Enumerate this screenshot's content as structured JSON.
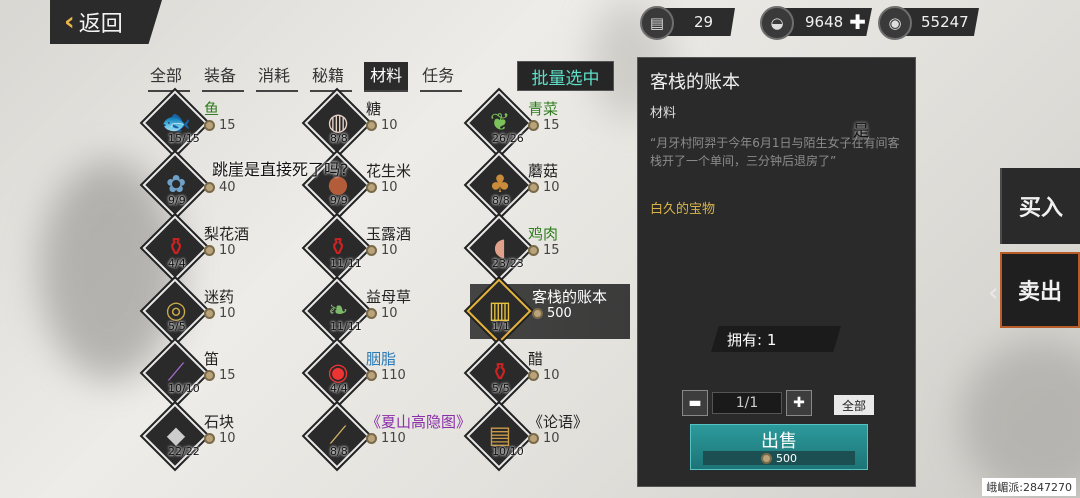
{
  "header": {
    "back_label": "返回",
    "currencies": [
      {
        "icon": "bag-icon",
        "value": "29"
      },
      {
        "icon": "silver-ingot-icon",
        "value": "9648"
      },
      {
        "icon": "copper-coin-icon",
        "value": "55247"
      }
    ]
  },
  "tabs": [
    {
      "label": "全部",
      "active": false
    },
    {
      "label": "装备",
      "active": false
    },
    {
      "label": "消耗",
      "active": false
    },
    {
      "label": "秘籍",
      "active": false
    },
    {
      "label": "材料",
      "active": true
    },
    {
      "label": "任务",
      "active": false
    }
  ],
  "batch_select_label": "批量选中",
  "items": [
    {
      "name": "鱼",
      "price": "15",
      "qty": "15/15",
      "color": "green",
      "icon": "fish-icon"
    },
    {
      "name": "糖",
      "price": "10",
      "qty": "8/8",
      "color": "",
      "icon": "sugar-icon"
    },
    {
      "name": "青菜",
      "price": "15",
      "qty": "26/26",
      "color": "green",
      "icon": "greens-icon"
    },
    {
      "name": "",
      "price": "40",
      "qty": "9/9",
      "color": "blue",
      "icon": "herb-icon"
    },
    {
      "name": "花生米",
      "price": "10",
      "qty": "9/9",
      "color": "",
      "icon": "peanut-icon"
    },
    {
      "name": "蘑菇",
      "price": "10",
      "qty": "8/8",
      "color": "",
      "icon": "mushroom-icon"
    },
    {
      "name": "梨花酒",
      "price": "10",
      "qty": "4/4",
      "color": "",
      "icon": "wine-jar-icon"
    },
    {
      "name": "玉露酒",
      "price": "10",
      "qty": "11/11",
      "color": "",
      "icon": "wine-jar-icon"
    },
    {
      "name": "鸡肉",
      "price": "15",
      "qty": "23/23",
      "color": "green",
      "icon": "meat-icon"
    },
    {
      "name": "迷药",
      "price": "10",
      "qty": "5/5",
      "color": "",
      "icon": "powder-icon"
    },
    {
      "name": "益母草",
      "price": "10",
      "qty": "11/11",
      "color": "",
      "icon": "grass-icon"
    },
    {
      "name": "客栈的账本",
      "price": "500",
      "qty": "1/1",
      "color": "",
      "icon": "ledger-icon",
      "selected": true
    },
    {
      "name": "笛",
      "price": "15",
      "qty": "10/10",
      "color": "",
      "icon": "flute-icon"
    },
    {
      "name": "胭脂",
      "price": "110",
      "qty": "4/4",
      "color": "blue",
      "icon": "rouge-icon"
    },
    {
      "name": "醋",
      "price": "10",
      "qty": "5/5",
      "color": "",
      "icon": "vinegar-jar-icon"
    },
    {
      "name": "石块",
      "price": "10",
      "qty": "22/22",
      "color": "",
      "icon": "rock-icon"
    },
    {
      "name": "《夏山高隐图》",
      "price": "110",
      "qty": "8/8",
      "color": "purple",
      "icon": "scroll-painting-icon"
    },
    {
      "name": "《论语》",
      "price": "10",
      "qty": "10/10",
      "color": "",
      "icon": "book-stack-icon"
    }
  ],
  "overlay_question": "跳崖是直接死了吗?",
  "detail": {
    "title": "客栈的账本",
    "type": "材料",
    "description": "“月牙村阿羿于今年6月1日与陌生女子在有间客栈开了一个单间，三分钟后退房了”",
    "quality": "白久的宝物",
    "owned": "拥有: 1",
    "stepper_value": "1/1",
    "all_label": "全部",
    "sell_label": "出售",
    "sell_price": "500",
    "overlay_word": "是"
  },
  "side_tabs": {
    "buy": "买入",
    "sell": "卖出"
  },
  "watermark": "峨嵋派:2847270"
}
